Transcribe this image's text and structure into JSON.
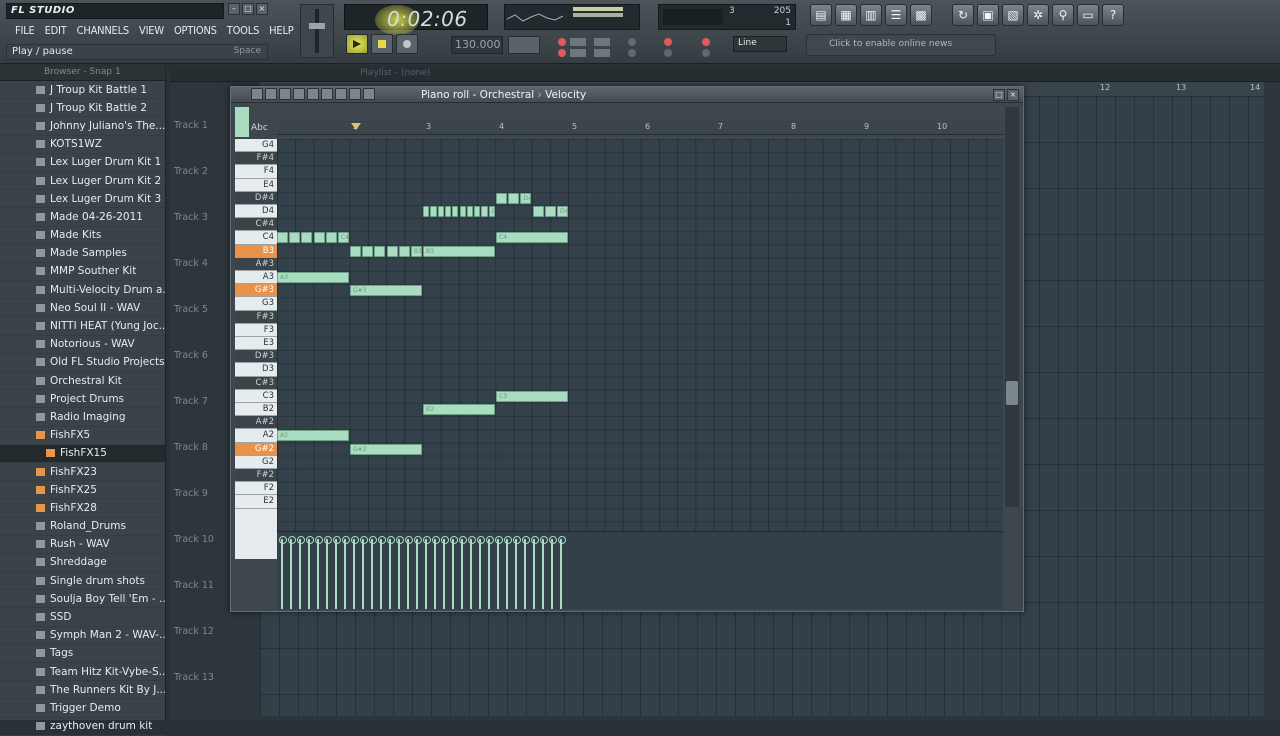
{
  "app": {
    "logo_text": "FL STUDIO"
  },
  "menu": [
    "FILE",
    "EDIT",
    "CHANNELS",
    "VIEW",
    "OPTIONS",
    "TOOLS",
    "HELP"
  ],
  "hint": {
    "text": "Play / pause",
    "shortcut": "Space"
  },
  "time": {
    "value": "0:02:06"
  },
  "tempo": {
    "value": "130.000"
  },
  "cpu": {
    "poly": "205",
    "val2": "3",
    "val3": "1"
  },
  "snap": {
    "mode": "Line"
  },
  "news": {
    "text": "Click to enable online news"
  },
  "browser": {
    "header": "Browser - Snap 1",
    "items": [
      {
        "label": "J Troup Kit Battle 1",
        "type": "folder"
      },
      {
        "label": "J Troup Kit Battle 2",
        "type": "folder"
      },
      {
        "label": "Johnny Juliano's The...",
        "type": "folder"
      },
      {
        "label": "KOTS1WZ",
        "type": "folder"
      },
      {
        "label": "Lex Luger Drum Kit 1",
        "type": "folder"
      },
      {
        "label": "Lex Luger Drum Kit 2",
        "type": "folder"
      },
      {
        "label": "Lex Luger Drum Kit 3",
        "type": "folder"
      },
      {
        "label": "Made 04-26-2011",
        "type": "folder"
      },
      {
        "label": "Made Kits",
        "type": "folder"
      },
      {
        "label": "Made Samples",
        "type": "folder"
      },
      {
        "label": "MMP Souther Kit",
        "type": "folder"
      },
      {
        "label": "Multi-Velocity Drum a...",
        "type": "folder"
      },
      {
        "label": "Neo Soul II - WAV",
        "type": "folder"
      },
      {
        "label": "NITTI HEAT (Yung Joc...",
        "type": "folder"
      },
      {
        "label": "Notorious - WAV",
        "type": "folder"
      },
      {
        "label": "Old FL Studio Projects",
        "type": "folder"
      },
      {
        "label": "Orchestral Kit",
        "type": "folder"
      },
      {
        "label": "Project Drums",
        "type": "folder"
      },
      {
        "label": "Radio Imaging",
        "type": "folder"
      },
      {
        "label": "FishFX5",
        "type": "orange"
      },
      {
        "label": "FishFX15",
        "type": "orange-sel"
      },
      {
        "label": "FishFX23",
        "type": "orange"
      },
      {
        "label": "FishFX25",
        "type": "orange"
      },
      {
        "label": "FishFX28",
        "type": "orange"
      },
      {
        "label": "Roland_Drums",
        "type": "folder"
      },
      {
        "label": "Rush - WAV",
        "type": "folder"
      },
      {
        "label": "Shreddage",
        "type": "folder"
      },
      {
        "label": "Single drum shots",
        "type": "folder"
      },
      {
        "label": "Soulja Boy Tell 'Em - ...",
        "type": "folder"
      },
      {
        "label": "SSD",
        "type": "folder"
      },
      {
        "label": "Symph Man 2 - WAV-...",
        "type": "folder"
      },
      {
        "label": "Tags",
        "type": "folder"
      },
      {
        "label": "Team Hitz Kit-Vybe-S...",
        "type": "folder"
      },
      {
        "label": "The Runners Kit By J...",
        "type": "folder"
      },
      {
        "label": "Trigger Demo",
        "type": "folder"
      },
      {
        "label": "zaythoven drum kit",
        "type": "folder"
      }
    ]
  },
  "playlist": {
    "title": "Playlist - (none)",
    "tracks": [
      "Track 1",
      "Track 2",
      "Track 3",
      "Track 4",
      "Track 5",
      "Track 6",
      "Track 7",
      "Track 8",
      "Track 9",
      "Track 10",
      "Track 11",
      "Track 12",
      "Track 13"
    ],
    "bar_labels": [
      "12",
      "13",
      "14"
    ]
  },
  "pianoroll": {
    "title": "Piano roll - Orchestral",
    "mode": "Velocity",
    "key_label": "Abc",
    "bars": [
      "2",
      "3",
      "4",
      "5",
      "6",
      "7",
      "8",
      "9",
      "10"
    ],
    "keys": [
      {
        "name": "G4",
        "black": false
      },
      {
        "name": "F#4",
        "black": true
      },
      {
        "name": "F4",
        "black": false
      },
      {
        "name": "E4",
        "black": false
      },
      {
        "name": "D#4",
        "black": true
      },
      {
        "name": "D4",
        "black": false
      },
      {
        "name": "C#4",
        "black": true
      },
      {
        "name": "C4",
        "black": false
      },
      {
        "name": "B3",
        "black": false,
        "hl": true
      },
      {
        "name": "A#3",
        "black": true
      },
      {
        "name": "A3",
        "black": false
      },
      {
        "name": "G#3",
        "black": true,
        "hl": true
      },
      {
        "name": "G3",
        "black": false
      },
      {
        "name": "F#3",
        "black": true
      },
      {
        "name": "F3",
        "black": false
      },
      {
        "name": "E3",
        "black": false
      },
      {
        "name": "D#3",
        "black": true
      },
      {
        "name": "D3",
        "black": false
      },
      {
        "name": "C#3",
        "black": true
      },
      {
        "name": "C3",
        "black": false
      },
      {
        "name": "B2",
        "black": false
      },
      {
        "name": "A#2",
        "black": true
      },
      {
        "name": "A2",
        "black": false
      },
      {
        "name": "G#2",
        "black": true,
        "hl": true
      },
      {
        "name": "G2",
        "black": false
      },
      {
        "name": "F#2",
        "black": true
      },
      {
        "name": "F2",
        "black": false
      },
      {
        "name": "E2",
        "black": false
      }
    ],
    "notes": [
      {
        "pitch": "C4",
        "start": 0,
        "len": 1,
        "label": "C4",
        "sub": 6
      },
      {
        "pitch": "A3",
        "start": 0,
        "len": 1,
        "label": "A3"
      },
      {
        "pitch": "A2",
        "start": 0,
        "len": 1,
        "label": "A2"
      },
      {
        "pitch": "B3",
        "start": 1,
        "len": 1,
        "label": "B3",
        "sub": 6
      },
      {
        "pitch": "G#3",
        "start": 1,
        "len": 1,
        "label": "G#3"
      },
      {
        "pitch": "G#2",
        "start": 1,
        "len": 1,
        "label": "G#2"
      },
      {
        "pitch": "D4",
        "start": 2,
        "len": 1,
        "label": "D4",
        "sub": 10
      },
      {
        "pitch": "B3",
        "start": 2,
        "len": 1,
        "label": "B3"
      },
      {
        "pitch": "B2",
        "start": 2,
        "len": 1,
        "label": "B2"
      },
      {
        "pitch": "D#4",
        "start": 3,
        "len": 0.5,
        "label": "D#4",
        "sub": 3
      },
      {
        "pitch": "D4",
        "start": 3.5,
        "len": 0.5,
        "label": "D4",
        "sub": 3
      },
      {
        "pitch": "C4",
        "start": 3,
        "len": 1,
        "label": "C4"
      },
      {
        "pitch": "C3",
        "start": 3,
        "len": 1,
        "label": "C3"
      }
    ],
    "velocity_count": 32
  }
}
